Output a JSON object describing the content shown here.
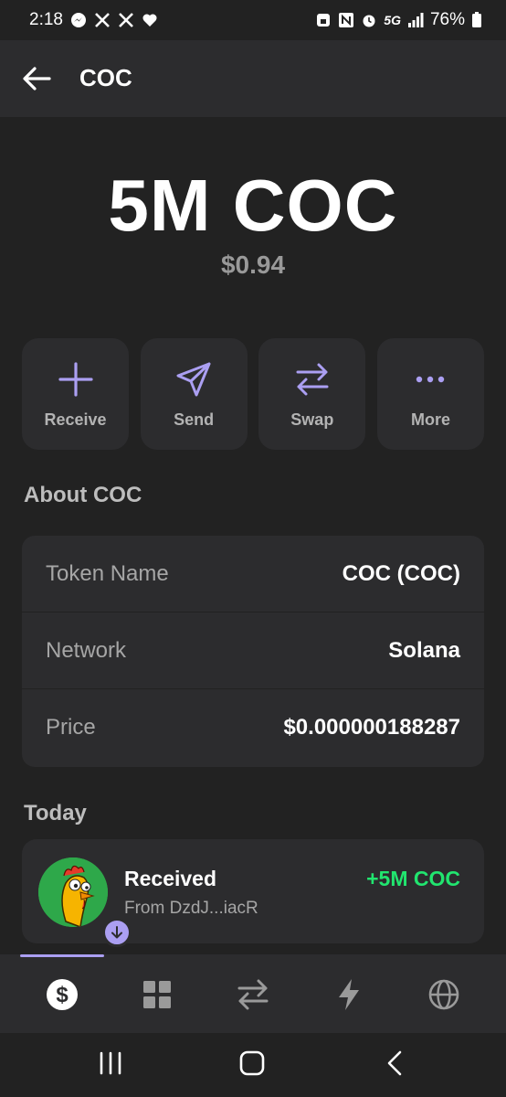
{
  "status_bar": {
    "time": "2:18",
    "network": "5G",
    "battery": "76%",
    "icons": [
      "messenger-icon",
      "x-icon",
      "x-icon",
      "heart-icon",
      "lock-icon",
      "nfc-icon",
      "alarm-icon",
      "signal-icon",
      "battery-icon"
    ]
  },
  "header": {
    "title": "COC",
    "back_icon": "arrow-left-icon"
  },
  "balance": {
    "amount": "5M COC",
    "usd": "$0.94"
  },
  "actions": [
    {
      "label": "Receive",
      "icon": "plus-icon"
    },
    {
      "label": "Send",
      "icon": "send-icon"
    },
    {
      "label": "Swap",
      "icon": "swap-icon"
    },
    {
      "label": "More",
      "icon": "more-icon"
    }
  ],
  "about": {
    "title": "About COC",
    "rows": [
      {
        "label": "Token Name",
        "value": "COC (COC)"
      },
      {
        "label": "Network",
        "value": "Solana"
      },
      {
        "label": "Price",
        "value": "$0.000000188287"
      }
    ]
  },
  "activity": {
    "section_title": "Today",
    "items": [
      {
        "title": "Received",
        "subtitle": "From DzdJ...iacR",
        "amount": "+5M COC",
        "badge_icon": "arrow-down-icon",
        "avatar_icon": "chicken-avatar-icon"
      }
    ]
  },
  "bottom_nav": {
    "items": [
      "dollar-icon",
      "grid-icon",
      "swap-icon",
      "lightning-icon",
      "globe-icon"
    ],
    "active": "dollar-icon"
  },
  "system_nav": {
    "items": [
      "recent-apps-icon",
      "home-icon",
      "back-icon"
    ]
  },
  "colors": {
    "background": "#222222",
    "card": "#2c2c2e",
    "accent": "#ab9ff2",
    "positive": "#21e56f",
    "muted": "#999999"
  }
}
